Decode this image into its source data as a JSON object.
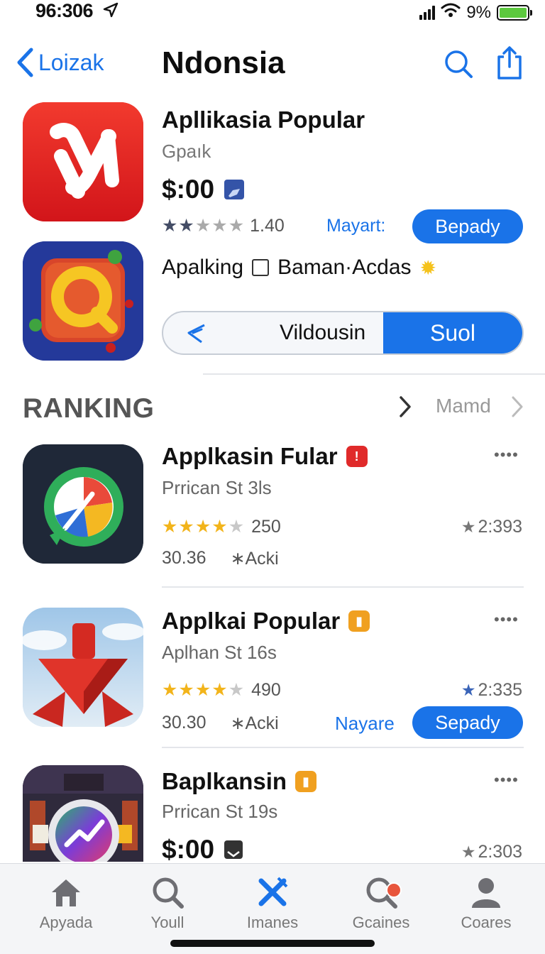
{
  "status": {
    "time": "96:306",
    "battery_percent": "9%",
    "battery_level": 1.0
  },
  "nav": {
    "back_label": "Loizak",
    "title": "Ndonsia"
  },
  "featured": {
    "title": "Apllikasia Popular",
    "subtitle": "Gpaık",
    "price": "$:00",
    "rating_value": "1.40",
    "stars_filled": 2,
    "stars_total": 5,
    "link_label": "Mayart:",
    "button_label": "Bepady",
    "meta_text_1": "Apalking",
    "meta_text_2": "Baman·Acdas",
    "segment_left_label": "Vildousin",
    "segment_right_label": "Suol"
  },
  "section": {
    "title": "RANKING",
    "more_label": "Mamd"
  },
  "apps": [
    {
      "title": "Applkasin Fular",
      "subtitle": "Prrican St 3ls",
      "rating_value": "250",
      "stars_filled": 4,
      "meta_left": "30.36",
      "meta_right": "∗Acki",
      "score": "2:393",
      "dots": "••••"
    },
    {
      "title": "Applkai Popular",
      "subtitle": "Aplhan St 16s",
      "rating_value": "490",
      "stars_filled": 4,
      "meta_left": "30.30",
      "meta_right": "∗Acki",
      "score": "2:335",
      "link_label": "Nayare",
      "button_label": "Sepady",
      "dots": "••••"
    },
    {
      "title": "Baplkansin",
      "subtitle": "Prrican St 19s",
      "price": "$:00",
      "score": "2:303",
      "dots": "••••"
    }
  ],
  "tabs": [
    {
      "label": "Apyada",
      "icon": "house-icon"
    },
    {
      "label": "Youll",
      "icon": "search-icon"
    },
    {
      "label": "Imanes",
      "icon": "tools-icon"
    },
    {
      "label": "Gcaines",
      "icon": "search-notification-icon"
    },
    {
      "label": "Coares",
      "icon": "person-icon"
    }
  ],
  "colors": {
    "accent": "#1a73e8",
    "star_gold": "#f2b41b",
    "badge_orange": "#f0a020",
    "badge_red": "#e02a2a"
  }
}
